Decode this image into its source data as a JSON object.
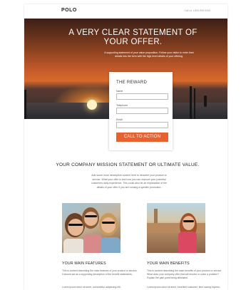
{
  "header": {
    "logo": "POLO",
    "phone": "Call us 1-800-999-9334"
  },
  "hero": {
    "title": "A VERY CLEAR STATEMENT OF YOUR OFFER.",
    "subtitle": "A supporting statement of your value proposition. Follow your visitor to enter their details into the form with the high level details of your offering."
  },
  "form": {
    "title": "THE REWARD",
    "name_label": "Name",
    "telephone_label": "Telephone",
    "email_label": "Email",
    "cta_label": "CALL TO ACTION"
  },
  "mission": {
    "title": "YOUR COMPANY MISSION STATEMENT OR ULTIMATE VALUE.",
    "description": "Add some more descriptive content here to describe your product or service. What your offer is and how you can improve your potential customers daily experience. This could also be an explanation of the details of your offer if you are running a specific promotion."
  },
  "features": {
    "title": "YOUR MAIN FEATURES",
    "text": "This is content describing the main features of your product or service. It should act as a supporting description of the benefit statements.",
    "more": "Lorem ipsum dolor sit amet, consectetur adipiscing elit."
  },
  "benefits": {
    "title": "YOUR MAIN BENEFITS",
    "text": "This is content describing the main benefits of your product or service. What does your company offer that will resolve or solve a problem? Explain the pain point being alleviated.",
    "more": "Lorem ipsum dolor sit amet, excellent customer, time saving experts."
  },
  "colors": {
    "accent": "#e8622f"
  }
}
